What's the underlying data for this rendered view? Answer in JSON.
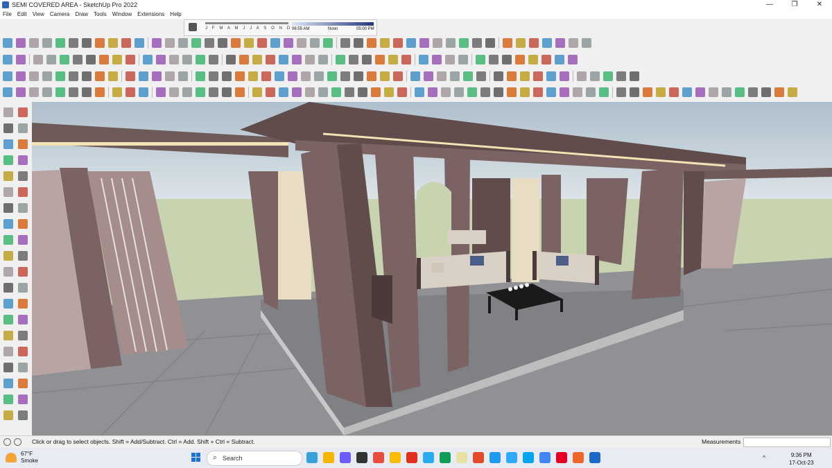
{
  "window": {
    "title": "SEMI COVERED AREA - SketchUp Pro 2022",
    "controls": [
      "—",
      "❐",
      "✕"
    ]
  },
  "menu": [
    "File",
    "Edit",
    "View",
    "Camera",
    "Draw",
    "Tools",
    "Window",
    "Extensions",
    "Help"
  ],
  "shadow_settings": {
    "months": "J F M A M J J A S O N D",
    "time_start": "06:55 AM",
    "time_noon": "Noon",
    "time_end": "05:00 PM"
  },
  "status": {
    "hint": "Click or drag to select objects. Shift = Add/Subtract. Ctrl = Add. Shift + Ctrl = Subtract.",
    "measurements_label": "Measurements",
    "measurements_value": ""
  },
  "taskbar": {
    "weather_temp": "67°F",
    "weather_desc": "Smoke",
    "search_placeholder": "Search",
    "time": "9:36 PM",
    "date": "17-Oct-23",
    "tray_expand": "^"
  },
  "colors": {
    "accent": "#1a73d9",
    "sky": "#c5d2dc",
    "grass": "#c8d4b0",
    "wood": "#7a6362",
    "ground": "#8f9195"
  }
}
